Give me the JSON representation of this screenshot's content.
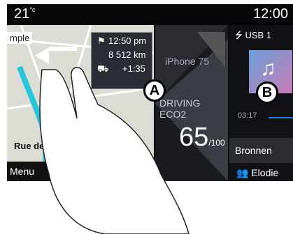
{
  "status": {
    "temperature": "21",
    "temp_unit": "°c",
    "clock": "12:00"
  },
  "map": {
    "place_label": "mple",
    "eta": "12:50 pm",
    "distance": "8 512 km",
    "delay": "+1:35",
    "street": "Rue de S",
    "menu_label": "Menu"
  },
  "phone": {
    "name": "iPhone 75",
    "mode": "DRIVING ECO2",
    "score": "65",
    "score_unit": "/100"
  },
  "media": {
    "source": "USB 1",
    "elapsed": "03:17",
    "button": "Bronnen",
    "user": "Elodie",
    "cover_colors": [
      "#6aa0d8",
      "#c87ab8"
    ],
    "progress": 0.55
  },
  "callouts": {
    "a": "A",
    "b": "B"
  }
}
